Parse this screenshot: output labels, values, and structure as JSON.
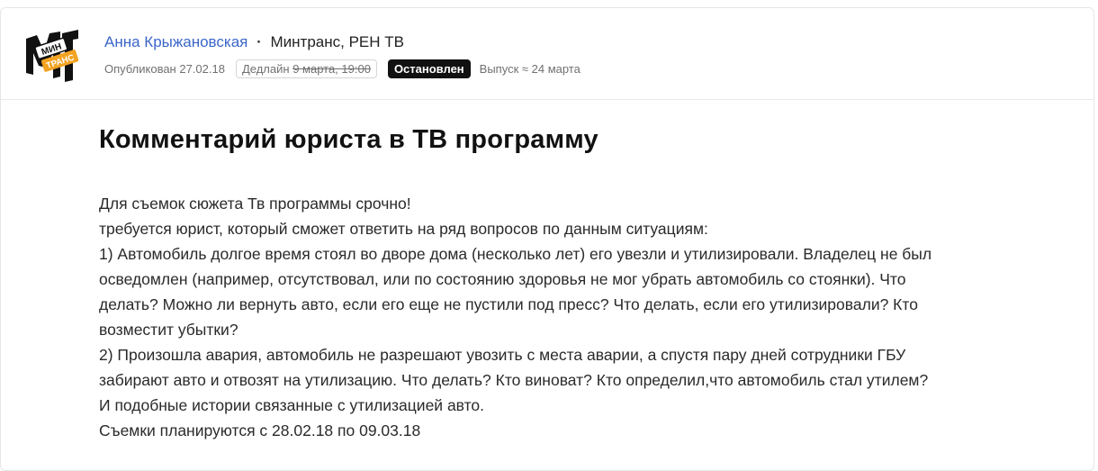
{
  "header": {
    "logo_text_top": "МИН",
    "logo_text_bottom": "ТРАНС",
    "author_name": "Анна Крыжановская",
    "separator": "·",
    "organization": "Минтранс, РЕН ТВ",
    "published": "Опубликован 27.02.18",
    "deadline_label": "Дедлайн",
    "deadline_value": "9 марта, 19:00",
    "status": "Остановлен",
    "release": "Выпуск ≈ 24 марта"
  },
  "post": {
    "title": "Комментарий юриста в ТВ программу",
    "lines": [
      "Для съемок сюжета Тв программы срочно!",
      "требуется юрист, который сможет ответить на ряд вопросов по данным ситуациям:",
      "1) Автомобиль долгое время стоял во дворе дома (несколько лет) его увезли и утилизировали. Владелец не был",
      "осведомлен (например, отсутствовал, или по состоянию здоровья не мог убрать автомобиль со стоянки). Что",
      "делать? Можно ли вернуть авто, если его еще не пустили под пресс? Что делать, если его утилизировали? Кто",
      "возместит убытки?",
      "2) Произошла авария, автомобиль не разрешают увозить с места аварии, а спустя пару дней сотрудники ГБУ",
      "забирают авто и отвозят на утилизацию. Что делать? Кто виноват? Кто определил,что автомобиль стал утилем?",
      "И подобные истории связанные с утилизацией авто.",
      "Съемки планируются с 28.02.18 по 09.03.18"
    ]
  },
  "colors": {
    "author_link": "#3a66c9",
    "status_bg": "#111111",
    "logo_accent": "#f3a321"
  }
}
